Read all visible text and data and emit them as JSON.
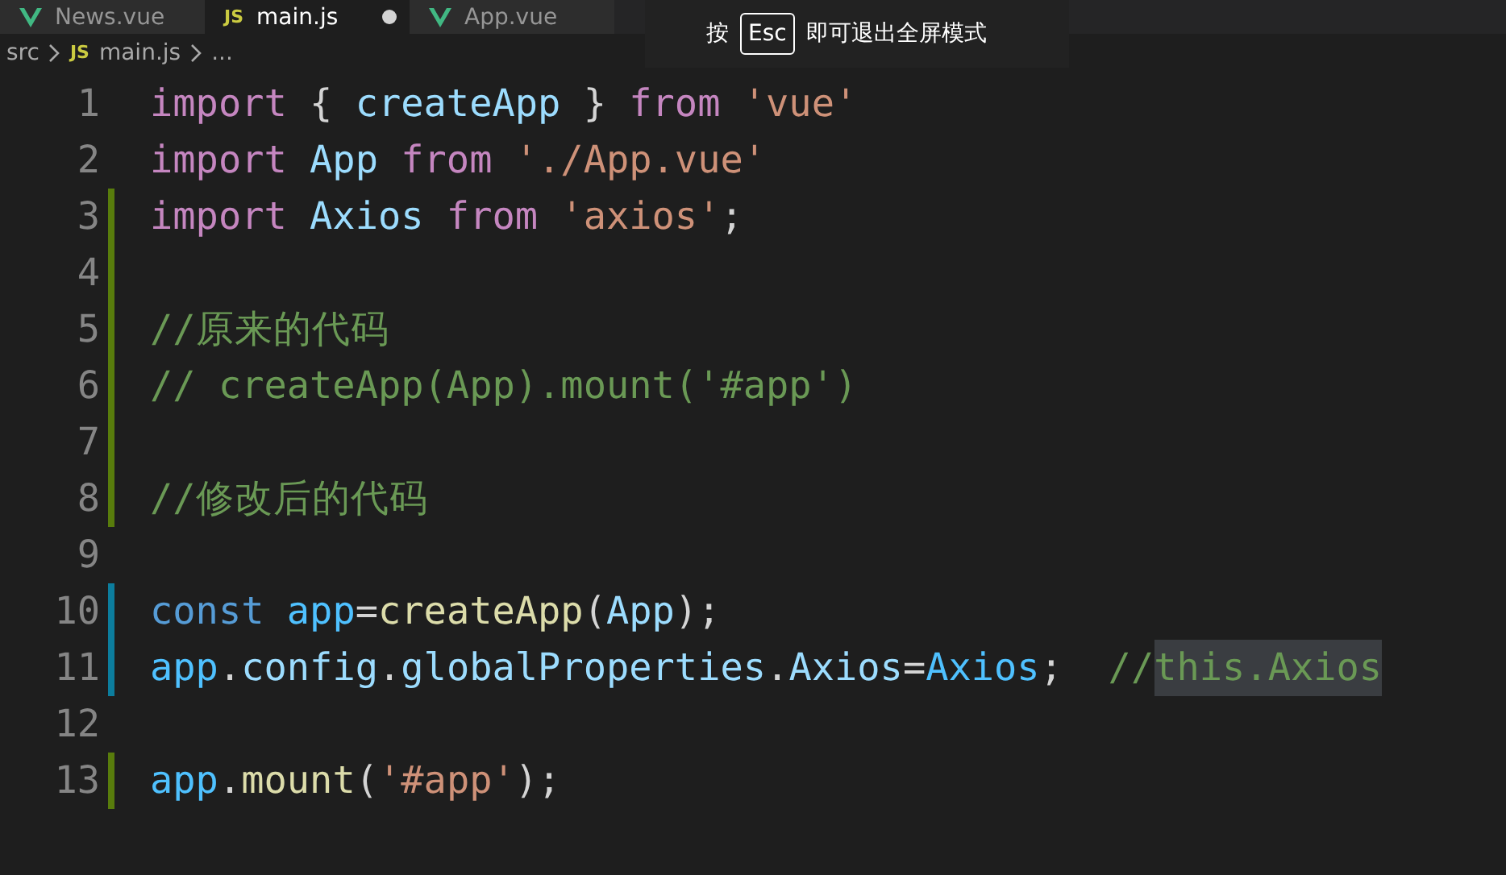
{
  "tabs": [
    {
      "label": "News.vue",
      "kind": "vue",
      "selected": false,
      "modified": false
    },
    {
      "label": "main.js",
      "kind": "js",
      "icon_label": "JS",
      "selected": true,
      "modified": true
    },
    {
      "label": "App.vue",
      "kind": "vue",
      "selected": false,
      "modified": false
    }
  ],
  "breadcrumb": [
    {
      "text": "src",
      "kind": "folder"
    },
    {
      "text": "main.js",
      "kind": "js",
      "icon_label": "JS"
    },
    {
      "text": "...",
      "kind": "more"
    }
  ],
  "fullscreen_hint": {
    "before": "按",
    "key": "Esc",
    "after": "即可退出全屏模式"
  },
  "lines": [
    {
      "number": "1",
      "kind": "plain",
      "tokens": [
        {
          "text": "import",
          "kind": "keyword"
        },
        {
          "text": " { ",
          "kind": "punct"
        },
        {
          "text": "createApp",
          "kind": "variable"
        },
        {
          "text": " } ",
          "kind": "punct"
        },
        {
          "text": "from",
          "kind": "keyword"
        },
        {
          "text": " 'vue'",
          "kind": "string"
        }
      ]
    },
    {
      "number": "2",
      "kind": "plain",
      "tokens": [
        {
          "text": "import",
          "kind": "keyword"
        },
        {
          "text": " App",
          "kind": "variable"
        },
        {
          "text": " from",
          "kind": "keyword"
        },
        {
          "text": " './App.vue'",
          "kind": "string"
        }
      ]
    },
    {
      "number": "3",
      "kind": "added",
      "tokens": [
        {
          "text": "import",
          "kind": "keyword"
        },
        {
          "text": " Axios",
          "kind": "variable"
        },
        {
          "text": " from",
          "kind": "keyword"
        },
        {
          "text": " 'axios'",
          "kind": "string"
        },
        {
          "text": ";",
          "kind": "punct"
        }
      ]
    },
    {
      "number": "4",
      "kind": "added"
    },
    {
      "number": "5",
      "kind": "added",
      "tokens": [
        {
          "text": "//原来的代码",
          "kind": "comment"
        }
      ]
    },
    {
      "number": "6",
      "kind": "added",
      "tokens": [
        {
          "text": "// createApp(App).mount('#app')",
          "kind": "comment"
        }
      ]
    },
    {
      "number": "7",
      "kind": "added"
    },
    {
      "number": "8",
      "kind": "added",
      "tokens": [
        {
          "text": "//修改后的代码",
          "kind": "comment"
        }
      ]
    },
    {
      "number": "9",
      "kind": "plain"
    },
    {
      "number": "10",
      "kind": "modified",
      "tokens": [
        {
          "text": "const",
          "kind": "storage"
        },
        {
          "text": " app",
          "kind": "constant"
        },
        {
          "text": "=",
          "kind": "punct"
        },
        {
          "text": "createApp",
          "kind": "function"
        },
        {
          "text": "(",
          "kind": "punct"
        },
        {
          "text": "App",
          "kind": "variable"
        },
        {
          "text": ");",
          "kind": "punct"
        }
      ]
    },
    {
      "number": "11",
      "kind": "modified",
      "tokens": [
        {
          "text": "app",
          "kind": "constant"
        },
        {
          "text": ".",
          "kind": "punct"
        },
        {
          "text": "config",
          "kind": "variable"
        },
        {
          "text": ".",
          "kind": "punct"
        },
        {
          "text": "globalProperties",
          "kind": "variable"
        },
        {
          "text": ".",
          "kind": "punct"
        },
        {
          "text": "Axios",
          "kind": "variable"
        },
        {
          "text": "=",
          "kind": "punct"
        },
        {
          "text": "Axios",
          "kind": "constant"
        },
        {
          "text": ";",
          "kind": "punct"
        },
        {
          "text": "  //",
          "kind": "comment"
        },
        {
          "text": "this.Axios",
          "kind": "comment_selected"
        }
      ]
    },
    {
      "number": "12",
      "kind": "plain"
    },
    {
      "number": "13",
      "kind": "added",
      "tokens": [
        {
          "text": "app",
          "kind": "constant"
        },
        {
          "text": ".",
          "kind": "punct"
        },
        {
          "text": "mount",
          "kind": "function"
        },
        {
          "text": "(",
          "kind": "punct"
        },
        {
          "text": "'#app'",
          "kind": "string"
        },
        {
          "text": ");",
          "kind": "punct"
        }
      ]
    }
  ]
}
